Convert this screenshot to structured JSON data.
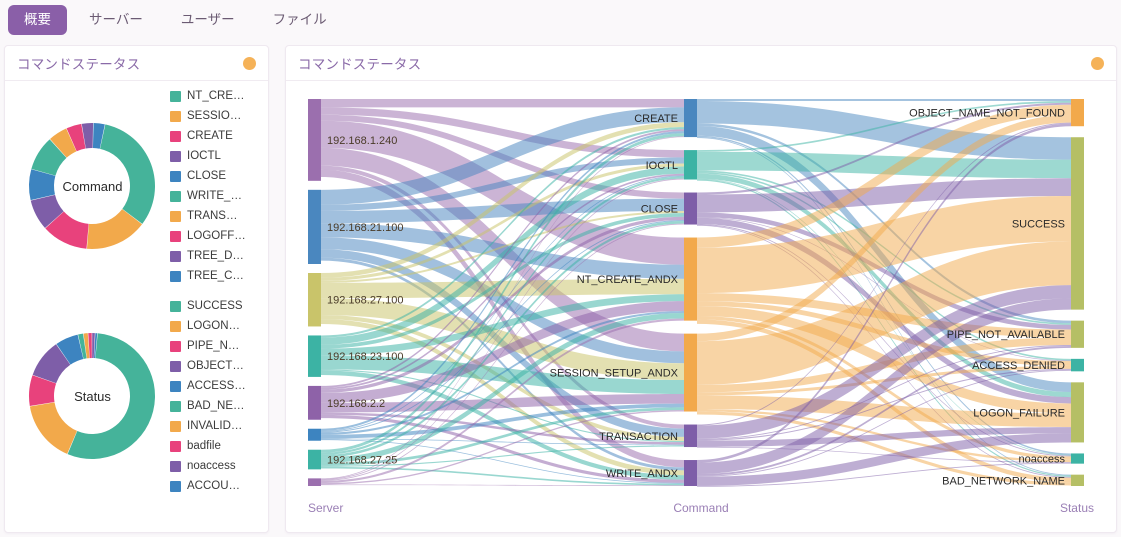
{
  "tabs": [
    {
      "label": "概要",
      "active": true
    },
    {
      "label": "サーバー",
      "active": false
    },
    {
      "label": "ユーザー",
      "active": false
    },
    {
      "label": "ファイル",
      "active": false
    }
  ],
  "panels": {
    "left": {
      "title": "コマンドステータス",
      "status_dot": "#f5b258"
    },
    "right": {
      "title": "コマンドステータス",
      "status_dot": "#f5b258"
    }
  },
  "chart_data": [
    {
      "type": "pie",
      "title": "Command",
      "center_label": "Command",
      "legend_position": "right",
      "categories": [
        "NT_CRE…",
        "SESSIO…",
        "CREATE",
        "IOCTL",
        "CLOSE",
        "WRITE_…",
        "TRANS…",
        "LOGOFF…",
        "TREE_D…",
        "TREE_C…"
      ],
      "full_categories": [
        "NT_CREATE_ANDX",
        "SESSION_SETUP_ANDX",
        "CREATE",
        "IOCTL",
        "CLOSE",
        "WRITE_ANDX",
        "TRANSACTION",
        "LOGOFF_ANDX",
        "TREE_DISCONNECT",
        "TREE_CONNECT_ANDX"
      ],
      "values": [
        32,
        16,
        12,
        8,
        8,
        9,
        5,
        4,
        3,
        3
      ],
      "colors": [
        "#45b39a",
        "#f2a94b",
        "#e8427c",
        "#7e5ea8",
        "#3d84c0",
        "#45b39a",
        "#f2a94b",
        "#e8427c",
        "#7e5ea8",
        "#3d84c0"
      ]
    },
    {
      "type": "pie",
      "title": "Status",
      "center_label": "Status",
      "legend_position": "right",
      "categories": [
        "SUCCESS",
        "LOGON…",
        "PIPE_N…",
        "OBJECT…",
        "ACCESS…",
        "BAD_NE…",
        "INVALID…",
        "badfile",
        "noaccess",
        "ACCOU…"
      ],
      "full_categories": [
        "SUCCESS",
        "LOGON_FAILURE",
        "PIPE_NOT_AVAILABLE",
        "OBJECT_NAME_NOT_FOUND",
        "ACCESS_DENIED",
        "BAD_NETWORK_NAME",
        "INVALID_PARAMETER",
        "badfile",
        "noaccess",
        "ACCOUNT_DISABLED"
      ],
      "values": [
        55,
        16,
        8,
        10,
        6,
        1.4,
        1.2,
        1,
        0.8,
        0.6
      ],
      "colors": [
        "#45b39a",
        "#f2a94b",
        "#e8427c",
        "#7e5ea8",
        "#3d84c0",
        "#45b39a",
        "#f2a94b",
        "#e8427c",
        "#7e5ea8",
        "#3d84c0"
      ]
    },
    {
      "type": "sankey",
      "title": "コマンドステータス",
      "axis_labels": [
        "Server",
        "Command",
        "Status"
      ],
      "columns": {
        "server": [
          {
            "label": "192.168.1.240",
            "value": 75,
            "color": "#9b6fae"
          },
          {
            "label": "192.168.21.100",
            "value": 68,
            "color": "#4a87bf"
          },
          {
            "label": "192.168.27.100",
            "value": 49,
            "color": "#c9c46a"
          },
          {
            "label": "192.168.23.100",
            "value": 38,
            "color": "#3cb3a4"
          },
          {
            "label": "192.168.2.2",
            "value": 31,
            "color": "#8e62a8"
          },
          {
            "label": "",
            "value": 11,
            "color": "#3d84c0"
          },
          {
            "label": "192.168.27.25",
            "value": 18,
            "color": "#3cb3a4"
          },
          {
            "label": "",
            "value": 7,
            "color": "#9b6fae"
          }
        ],
        "command": [
          {
            "label": "CREATE",
            "value": 44,
            "color": "#4a87bf"
          },
          {
            "label": "IOCTL",
            "value": 34,
            "color": "#3cb3a4"
          },
          {
            "label": "CLOSE",
            "value": 37,
            "color": "#7e5ea8"
          },
          {
            "label": "NT_CREATE_ANDX",
            "value": 96,
            "color": "#f2a94b"
          },
          {
            "label": "SESSION_SETUP_ANDX",
            "value": 90,
            "color": "#f2a94b"
          },
          {
            "label": "TRANSACTION",
            "value": 26,
            "color": "#7e5ea8"
          },
          {
            "label": "WRITE_ANDX",
            "value": 30,
            "color": "#7e5ea8"
          }
        ],
        "status": [
          {
            "label": "OBJECT_NAME_NOT_FOUND",
            "value": 24,
            "color": "#f2a94b"
          },
          {
            "label": "SUCCESS",
            "value": 152,
            "color": "#b5bf65"
          },
          {
            "label": "PIPE_NOT_AVAILABLE",
            "value": 24,
            "color": "#b5bf65"
          },
          {
            "label": "ACCESS_DENIED",
            "value": 11,
            "color": "#3cb3a4"
          },
          {
            "label": "LOGON_FAILURE",
            "value": 53,
            "color": "#b5bf65"
          },
          {
            "label": "noaccess",
            "value": 9,
            "color": "#3cb3a4"
          },
          {
            "label": "BAD_NETWORK_NAME",
            "value": 10,
            "color": "#b5bf65"
          }
        ]
      }
    }
  ]
}
